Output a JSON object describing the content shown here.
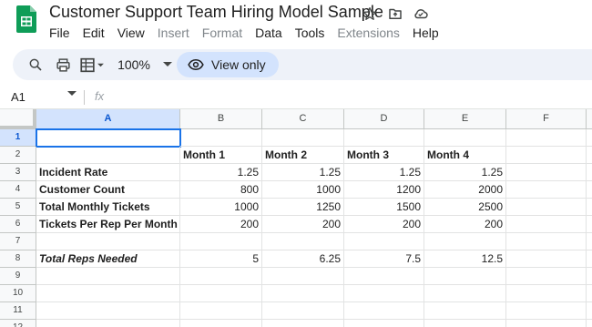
{
  "app": {
    "title": "Customer Support Team Hiring Model Sample",
    "colors": {
      "sheets_green": "#0f9d58",
      "accent_blue": "#0b57d0",
      "selection": "#d3e3fd"
    }
  },
  "menu": {
    "items": [
      {
        "label": "File",
        "enabled": true
      },
      {
        "label": "Edit",
        "enabled": true
      },
      {
        "label": "View",
        "enabled": true
      },
      {
        "label": "Insert",
        "enabled": false
      },
      {
        "label": "Format",
        "enabled": false
      },
      {
        "label": "Data",
        "enabled": true
      },
      {
        "label": "Tools",
        "enabled": true
      },
      {
        "label": "Extensions",
        "enabled": false
      },
      {
        "label": "Help",
        "enabled": true
      }
    ]
  },
  "toolbar": {
    "zoom": "100%",
    "view_only_label": "View only",
    "icons": [
      "search-icon",
      "print-icon",
      "format-table-icon",
      "eye-icon"
    ]
  },
  "formula_bar": {
    "name_box": "A1",
    "fx_label": "fx",
    "value": ""
  },
  "sheet": {
    "columns": [
      "A",
      "B",
      "C",
      "D",
      "E",
      "F"
    ],
    "rows": [
      "1",
      "2",
      "3",
      "4",
      "5",
      "6",
      "7",
      "8",
      "9",
      "10",
      "11",
      "12"
    ],
    "selected_cell": "A1",
    "cells": {
      "B2": "Month 1",
      "C2": "Month 2",
      "D2": "Month 3",
      "E2": "Month 4",
      "A3": "Incident Rate",
      "B3": "1.25",
      "C3": "1.25",
      "D3": "1.25",
      "E3": "1.25",
      "A4": "Customer Count",
      "B4": "800",
      "C4": "1000",
      "D4": "1200",
      "E4": "2000",
      "A5": "Total Monthly Tickets",
      "B5": "1000",
      "C5": "1250",
      "D5": "1500",
      "E5": "2500",
      "A6": "Tickets Per Rep Per Month",
      "B6": "200",
      "C6": "200",
      "D6": "200",
      "E6": "200",
      "A8": "Total Reps Needed",
      "B8": "5",
      "C8": "6.25",
      "D8": "7.5",
      "E8": "12.5"
    }
  }
}
